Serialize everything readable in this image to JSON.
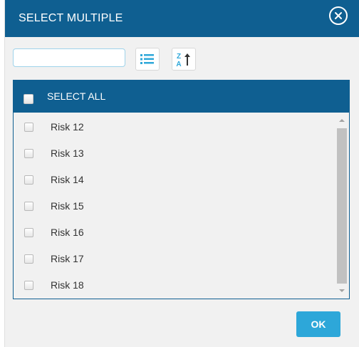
{
  "dialog": {
    "title": "SELECT MULTIPLE",
    "close_icon": "close-circle-icon"
  },
  "toolbar": {
    "search_value": "",
    "search_placeholder": "",
    "list_icon": "list-icon",
    "sort_icon": "sort-za-icon",
    "sort_letters": [
      "Z",
      "A"
    ]
  },
  "list": {
    "select_all_label": "SELECT ALL",
    "select_all_checked": false,
    "items": [
      {
        "label": "Risk 12",
        "checked": false
      },
      {
        "label": "Risk 13",
        "checked": false
      },
      {
        "label": "Risk 14",
        "checked": false
      },
      {
        "label": "Risk 15",
        "checked": false
      },
      {
        "label": "Risk 16",
        "checked": false
      },
      {
        "label": "Risk 17",
        "checked": false
      },
      {
        "label": "Risk 18",
        "checked": false
      }
    ]
  },
  "footer": {
    "ok_label": "OK"
  },
  "colors": {
    "header_blue": "#0f5f91",
    "accent_cyan": "#2da7d9",
    "background": "#f1f1f1"
  }
}
